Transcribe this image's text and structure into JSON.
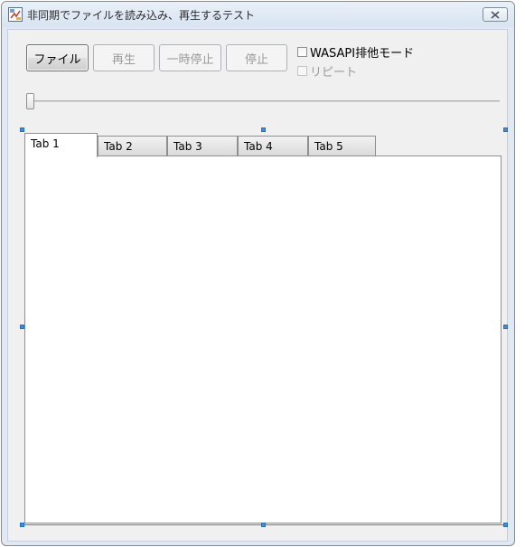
{
  "window": {
    "title": "非同期でファイルを読み込み、再生するテスト"
  },
  "toolbar": {
    "file_label": "ファイル",
    "play_label": "再生",
    "pause_label": "一時停止",
    "stop_label": "停止"
  },
  "options": {
    "wasapi_label": "WASAPI排他モード",
    "repeat_label": "リピート"
  },
  "tabs": [
    {
      "label": "Tab 1",
      "selected": true
    },
    {
      "label": "Tab 2",
      "selected": false
    },
    {
      "label": "Tab 3",
      "selected": false
    },
    {
      "label": "Tab 4",
      "selected": false
    },
    {
      "label": "Tab 5",
      "selected": false
    }
  ],
  "colors": {
    "selection_handle": "#3c8fe6",
    "window_frame": "#dfe8f3"
  }
}
